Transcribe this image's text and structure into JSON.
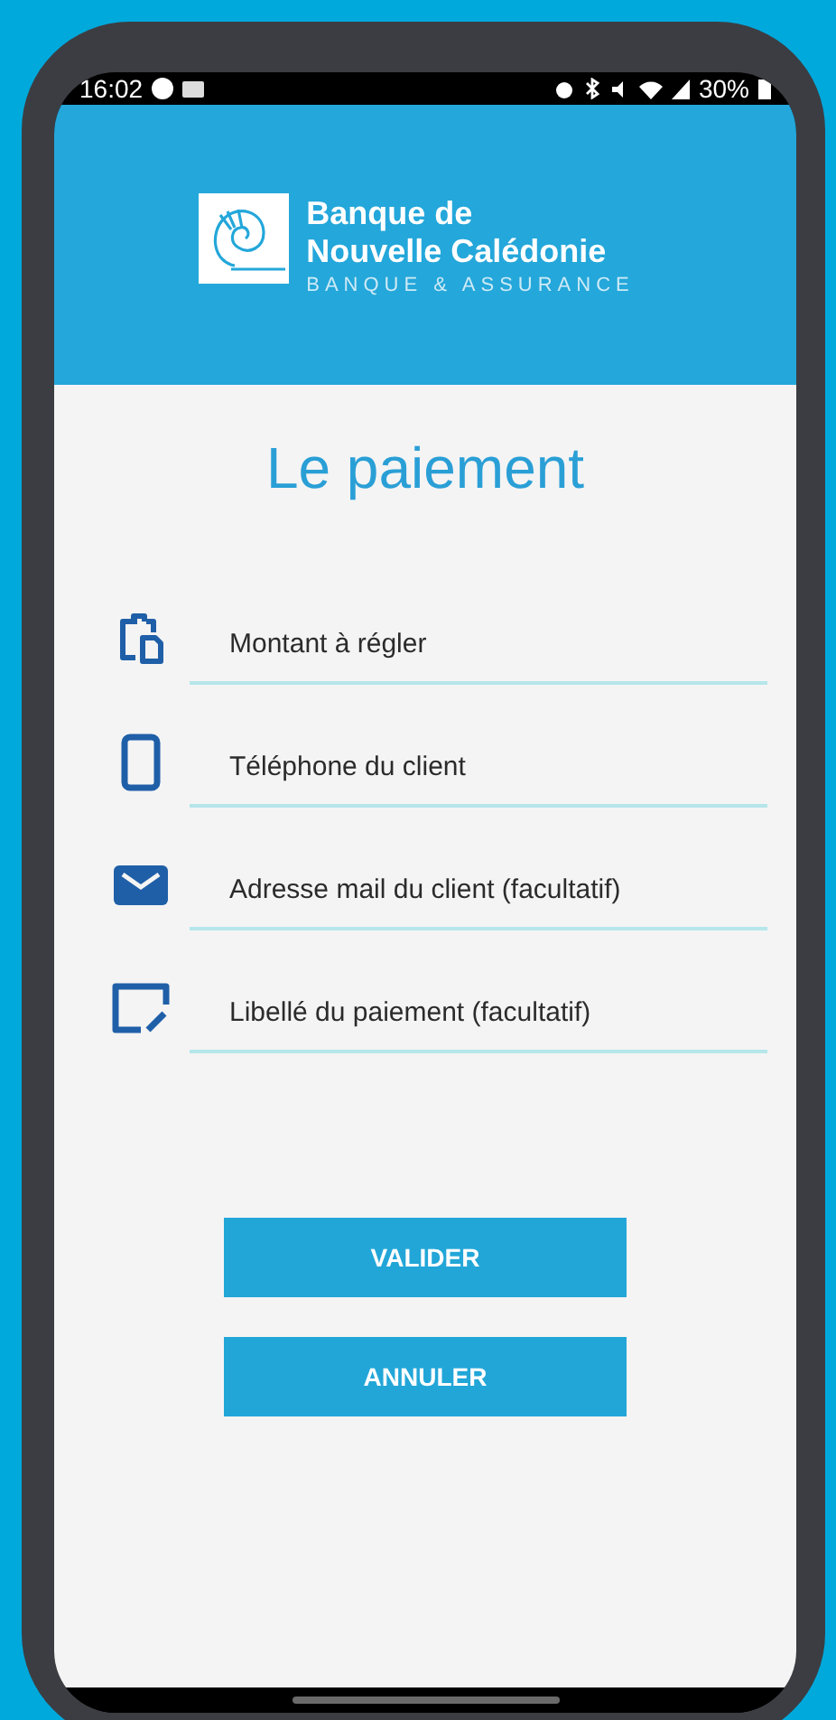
{
  "status_bar": {
    "time": "16:02",
    "battery": "30%"
  },
  "header": {
    "brand_line_1": "Banque de",
    "brand_line_2": "Nouvelle Calédonie",
    "tagline": "BANQUE & ASSURANCE"
  },
  "title": "Le paiement",
  "fields": [
    {
      "kind": "amount",
      "placeholder": "Montant à régler"
    },
    {
      "kind": "phone",
      "placeholder": "Téléphone du client"
    },
    {
      "kind": "mail",
      "placeholder": "Adresse mail du client (facultatif)"
    },
    {
      "kind": "note",
      "placeholder": "Libellé du paiement (facultatif)"
    }
  ],
  "buttons": [
    "VALIDER",
    "ANNULER"
  ]
}
